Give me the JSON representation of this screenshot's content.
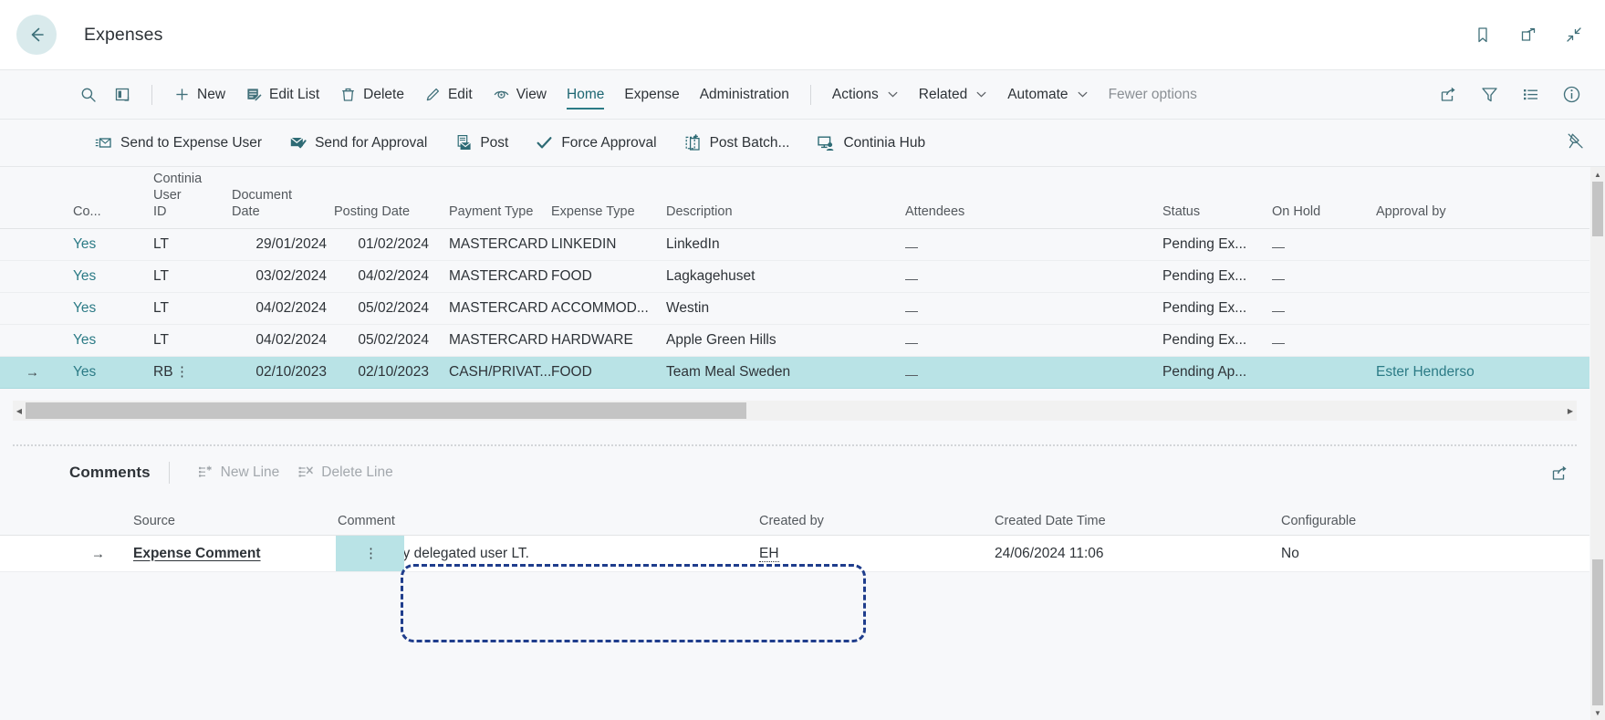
{
  "titlebar": {
    "back_icon": "arrow-left-icon",
    "title": "Expenses",
    "icons": [
      {
        "name": "bookmark-icon"
      },
      {
        "name": "open-in-new-window-icon"
      },
      {
        "name": "collapse-icon"
      }
    ]
  },
  "commandbar": {
    "search_icon": "search-icon",
    "focus_icon": "focus-mode-icon",
    "items": [
      {
        "label": "New",
        "icon": "plus-icon"
      },
      {
        "label": "Edit List",
        "icon": "edit-list-icon"
      },
      {
        "label": "Delete",
        "icon": "trash-icon"
      },
      {
        "label": "Edit",
        "icon": "pencil-icon"
      },
      {
        "label": "View",
        "icon": "eye-icon"
      }
    ],
    "tabs": [
      {
        "label": "Home",
        "active": true
      },
      {
        "label": "Expense",
        "active": false
      },
      {
        "label": "Administration",
        "active": false
      }
    ],
    "dropdowns": [
      {
        "label": "Actions"
      },
      {
        "label": "Related"
      },
      {
        "label": "Automate"
      }
    ],
    "fewer_options": "Fewer options",
    "right_icons": [
      {
        "name": "share-icon"
      },
      {
        "name": "filter-icon"
      },
      {
        "name": "list-icon"
      },
      {
        "name": "info-icon"
      }
    ]
  },
  "actionbar": {
    "items": [
      {
        "label": "Send to Expense User",
        "icon": "send-mail-icon"
      },
      {
        "label": "Send for Approval",
        "icon": "approval-mail-icon"
      },
      {
        "label": "Post",
        "icon": "post-icon"
      },
      {
        "label": "Force Approval",
        "icon": "check-icon"
      },
      {
        "label": "Post Batch...",
        "icon": "post-batch-icon"
      },
      {
        "label": "Continia Hub",
        "icon": "continia-hub-icon"
      }
    ],
    "pin_icon": "unpin-icon"
  },
  "grid": {
    "columns": [
      "Co...",
      "Continia User\nID",
      "Document\nDate",
      "Posting Date",
      "Payment Type",
      "Expense Type",
      "Description",
      "Attendees",
      "Status",
      "On Hold",
      "Approval by"
    ],
    "rows": [
      {
        "co": "Yes",
        "user": "LT",
        "doc_date": "29/01/2024",
        "posting_date": "01/02/2024",
        "payment_type": "MASTERCARD",
        "expense_type": "LINKEDIN",
        "description": "LinkedIn",
        "attendees": "_",
        "status": "Pending Ex...",
        "on_hold": "_",
        "approval_by": "",
        "selected": false
      },
      {
        "co": "Yes",
        "user": "LT",
        "doc_date": "03/02/2024",
        "posting_date": "04/02/2024",
        "payment_type": "MASTERCARD",
        "expense_type": "FOOD",
        "description": "Lagkagehuset",
        "attendees": "_",
        "status": "Pending Ex...",
        "on_hold": "_",
        "approval_by": "",
        "selected": false
      },
      {
        "co": "Yes",
        "user": "LT",
        "doc_date": "04/02/2024",
        "posting_date": "05/02/2024",
        "payment_type": "MASTERCARD",
        "expense_type": "ACCOMMOD...",
        "description": "Westin",
        "attendees": "_",
        "status": "Pending Ex...",
        "on_hold": "_",
        "approval_by": "",
        "selected": false
      },
      {
        "co": "Yes",
        "user": "LT",
        "doc_date": "04/02/2024",
        "posting_date": "05/02/2024",
        "payment_type": "MASTERCARD",
        "expense_type": "HARDWARE",
        "description": "Apple Green Hills",
        "attendees": "_",
        "status": "Pending Ex...",
        "on_hold": "_",
        "approval_by": "",
        "selected": false
      },
      {
        "co": "Yes",
        "user": "RB",
        "doc_date": "02/10/2023",
        "posting_date": "02/10/2023",
        "payment_type": "CASH/PRIVAT...",
        "expense_type": "FOOD",
        "description": "Team Meal Sweden",
        "attendees": "_",
        "status": "Pending Ap...",
        "on_hold": "",
        "approval_by": "Ester Henderso",
        "selected": true
      }
    ]
  },
  "comments": {
    "title": "Comments",
    "actions": [
      {
        "label": "New Line",
        "icon": "new-line-icon",
        "disabled": true
      },
      {
        "label": "Delete Line",
        "icon": "delete-line-icon",
        "disabled": true
      }
    ],
    "share_icon": "share-icon",
    "columns": [
      "Source",
      "Comment",
      "Created by",
      "Created Date Time",
      "Configurable"
    ],
    "rows": [
      {
        "source": "Expense Comment",
        "comment": "Updated by delegated user LT.",
        "created_by": "EH",
        "created_date_time": "24/06/2024 11:06",
        "configurable": "No"
      }
    ]
  },
  "annotation": {
    "target": "comment-cell-highlight",
    "color": "#1f3d8c"
  },
  "colors": {
    "accent": "#2c7b86",
    "selection": "#b9e3e6",
    "chrome": "#f7f8fa"
  }
}
